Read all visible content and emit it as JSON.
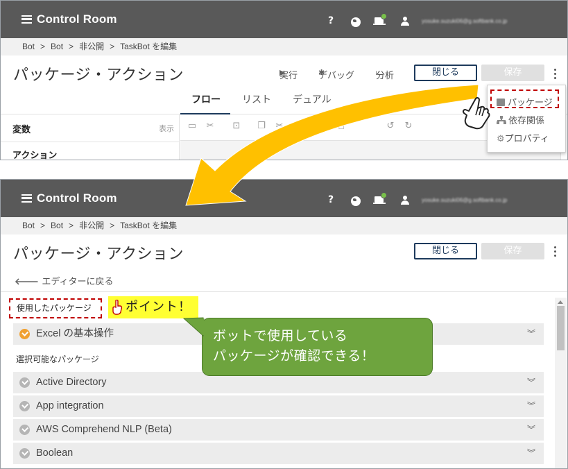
{
  "app": {
    "title": "Control Room",
    "user_email": "yosuke.suzuki06@g.softbank.co.jp"
  },
  "header_icons": [
    "help-icon",
    "globe-icon",
    "bot-status-icon",
    "user-icon"
  ],
  "breadcrumb": [
    "Bot",
    ">",
    "Bot",
    ">",
    "非公開",
    ">",
    "TaskBot を編集"
  ],
  "editor": {
    "title": "パッケージ・アクション",
    "run": "実行",
    "debug": "デバッグ",
    "analyze": "分析",
    "close": "閉じる",
    "save": "保存",
    "tabs": [
      "フロー",
      "リスト",
      "デュアル"
    ],
    "variables": "変数",
    "show": "表示",
    "actions": "アクション",
    "menu": {
      "packages": "パッケージ",
      "dependencies": "依存関係",
      "properties": "プロパティ"
    }
  },
  "packages_page": {
    "title": "パッケージ・アクション",
    "close": "閉じる",
    "save": "保存",
    "back": "エディターに戻る",
    "used_label": "使用したパッケージ",
    "point": "ポイント！",
    "used_packages": [
      "Excel の基本操作"
    ],
    "available_label": "選択可能なパッケージ",
    "available_packages": [
      "Active Directory",
      "App integration",
      "AWS Comprehend NLP (Beta)",
      "Boolean"
    ]
  },
  "callout": {
    "line1": "ボットで使用している",
    "line2": "パッケージが確認できる！"
  },
  "colors": {
    "header_bg": "#595959",
    "primary_button": "#1d3a5c",
    "highlight_dash": "#c00000",
    "arrow": "#ffc000",
    "callout": "#6ea43e",
    "point_bg": "#ffff33",
    "used_check": "#f0a030"
  }
}
